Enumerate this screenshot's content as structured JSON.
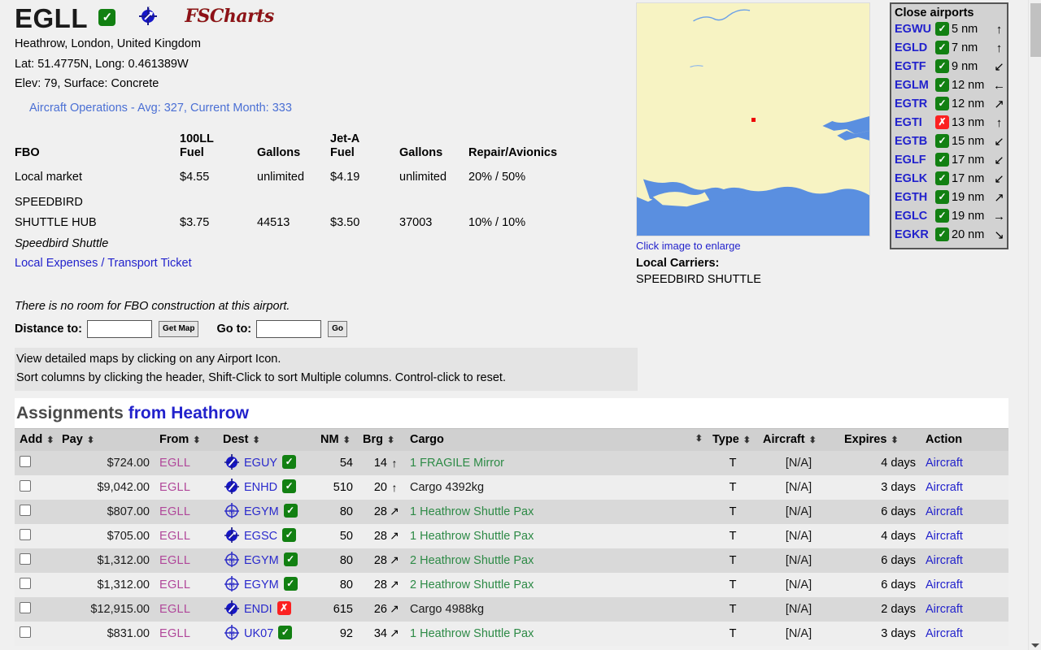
{
  "airport": {
    "icao": "EGLL",
    "status_badge": "check",
    "charts_logo": "FSCharts",
    "location": "Heathrow, London, United Kingdom",
    "latlong": "Lat: 51.4775N, Long: 0.461389W",
    "elev_surface": "Elev: 79, Surface: Concrete",
    "operations": "Aircraft Operations - Avg: 327, Current Month: 333"
  },
  "fbo": {
    "headers": [
      "FBO",
      "100LL Fuel",
      "Gallons",
      "Jet-A Fuel",
      "Gallons",
      "Repair/Avionics"
    ],
    "headers_split": {
      "fbo": "FBO",
      "fuel100ll_l1": "100LL",
      "fuel100ll_l2": "Fuel",
      "gallons1": "Gallons",
      "jeta_l1": "Jet-A",
      "jeta_l2": "Fuel",
      "gallons2": "Gallons",
      "repair": "Repair/Avionics"
    },
    "rows": [
      {
        "name": "Local market",
        "name2": "",
        "fuel100ll": "$4.55",
        "gallons1": "unlimited",
        "jeta": "$4.19",
        "gallons2": "unlimited",
        "repair": "20% / 50%"
      },
      {
        "name": "SPEEDBIRD",
        "name2": "SHUTTLE HUB",
        "fuel100ll": "$3.75",
        "gallons1": "44513",
        "jeta": "$3.50",
        "gallons2": "37003",
        "repair": "10% / 10%"
      }
    ],
    "owner_note": "Speedbird Shuttle",
    "expenses_link": "Local Expenses / Transport Ticket"
  },
  "map": {
    "caption_link": "Click image to enlarge",
    "carriers_label": "Local Carriers:",
    "carriers_value": "SPEEDBIRD SHUTTLE",
    "land_color": "#f7f3c3",
    "water_color": "#5a8fe0",
    "marker_color": "#ee0000"
  },
  "close_airports": {
    "title": "Close airports",
    "items": [
      {
        "code": "EGWU",
        "ok": true,
        "dist": "5 nm",
        "arrow": "↑"
      },
      {
        "code": "EGLD",
        "ok": true,
        "dist": "7 nm",
        "arrow": "↑"
      },
      {
        "code": "EGTF",
        "ok": true,
        "dist": "9 nm",
        "arrow": "↙"
      },
      {
        "code": "EGLM",
        "ok": true,
        "dist": "12 nm",
        "arrow": "←"
      },
      {
        "code": "EGTR",
        "ok": true,
        "dist": "12 nm",
        "arrow": "↗"
      },
      {
        "code": "EGTI",
        "ok": false,
        "dist": "13 nm",
        "arrow": "↑"
      },
      {
        "code": "EGTB",
        "ok": true,
        "dist": "15 nm",
        "arrow": "↙"
      },
      {
        "code": "EGLF",
        "ok": true,
        "dist": "17 nm",
        "arrow": "↙"
      },
      {
        "code": "EGLK",
        "ok": true,
        "dist": "17 nm",
        "arrow": "↙"
      },
      {
        "code": "EGTH",
        "ok": true,
        "dist": "19 nm",
        "arrow": "↗"
      },
      {
        "code": "EGLC",
        "ok": true,
        "dist": "19 nm",
        "arrow": "→"
      },
      {
        "code": "EGKR",
        "ok": true,
        "dist": "20 nm",
        "arrow": "↘"
      }
    ]
  },
  "fbo_note": "There is no room for FBO construction at this airport.",
  "form": {
    "distance_label": "Distance to:",
    "distance_value": "",
    "distance_placeholder": "",
    "get_map_label": "Get Map",
    "goto_label": "Go to:",
    "goto_value": "",
    "goto_placeholder": "",
    "go_label": "Go"
  },
  "help": {
    "line1": "View detailed maps by clicking on any Airport Icon.",
    "line2": "Sort columns by clicking the header, Shift-Click to sort Multiple columns. Control-click to reset."
  },
  "assignments": {
    "title_1": "Assignments",
    "title_2": "from Heathrow",
    "columns": [
      {
        "key": "add",
        "label": "Add",
        "sortable": true
      },
      {
        "key": "pay",
        "label": "Pay",
        "sortable": true
      },
      {
        "key": "from",
        "label": "From",
        "sortable": true
      },
      {
        "key": "dest",
        "label": "Dest",
        "sortable": true
      },
      {
        "key": "nm",
        "label": "NM",
        "sortable": true
      },
      {
        "key": "brg",
        "label": "Brg",
        "sortable": true
      },
      {
        "key": "cargo",
        "label": "Cargo",
        "sortable": true
      },
      {
        "key": "type",
        "label": "Type",
        "sortable": true
      },
      {
        "key": "acft",
        "label": "Aircraft",
        "sortable": true
      },
      {
        "key": "exp",
        "label": "Expires",
        "sortable": true
      },
      {
        "key": "action",
        "label": "Action",
        "sortable": false
      }
    ],
    "sort_glyph": "⬍",
    "rows": [
      {
        "checked": false,
        "pay": "$724.00",
        "from": "EGLL",
        "dest_icon": "vor-compass-icon",
        "dest": "EGUY",
        "dest_ok": true,
        "nm": "54",
        "brg": "14",
        "brg_arrow": "↑",
        "cargo": "1 FRAGILE Mirror",
        "cargo_pax": true,
        "type": "T",
        "aircraft": "[N/A]",
        "expires": "4 days",
        "action": "Aircraft"
      },
      {
        "checked": false,
        "pay": "$9,042.00",
        "from": "EGLL",
        "dest_icon": "vor-compass-icon",
        "dest": "ENHD",
        "dest_ok": true,
        "nm": "510",
        "brg": "20",
        "brg_arrow": "↑",
        "cargo": "Cargo 4392kg",
        "cargo_pax": false,
        "type": "T",
        "aircraft": "[N/A]",
        "expires": "3 days",
        "action": "Aircraft"
      },
      {
        "checked": false,
        "pay": "$807.00",
        "from": "EGLL",
        "dest_icon": "vordme-compass-icon",
        "dest": "EGYM",
        "dest_ok": true,
        "nm": "80",
        "brg": "28",
        "brg_arrow": "↗",
        "cargo": "1 Heathrow Shuttle Pax",
        "cargo_pax": true,
        "type": "T",
        "aircraft": "[N/A]",
        "expires": "6 days",
        "action": "Aircraft"
      },
      {
        "checked": false,
        "pay": "$705.00",
        "from": "EGLL",
        "dest_icon": "ndb-compass-icon",
        "dest": "EGSC",
        "dest_ok": true,
        "nm": "50",
        "brg": "28",
        "brg_arrow": "↗",
        "cargo": "1 Heathrow Shuttle Pax",
        "cargo_pax": true,
        "type": "T",
        "aircraft": "[N/A]",
        "expires": "4 days",
        "action": "Aircraft"
      },
      {
        "checked": false,
        "pay": "$1,312.00",
        "from": "EGLL",
        "dest_icon": "vordme-compass-icon",
        "dest": "EGYM",
        "dest_ok": true,
        "nm": "80",
        "brg": "28",
        "brg_arrow": "↗",
        "cargo": "2 Heathrow Shuttle Pax",
        "cargo_pax": true,
        "type": "T",
        "aircraft": "[N/A]",
        "expires": "6 days",
        "action": "Aircraft"
      },
      {
        "checked": false,
        "pay": "$1,312.00",
        "from": "EGLL",
        "dest_icon": "vordme-compass-icon",
        "dest": "EGYM",
        "dest_ok": true,
        "nm": "80",
        "brg": "28",
        "brg_arrow": "↗",
        "cargo": "2 Heathrow Shuttle Pax",
        "cargo_pax": true,
        "type": "T",
        "aircraft": "[N/A]",
        "expires": "6 days",
        "action": "Aircraft"
      },
      {
        "checked": false,
        "pay": "$12,915.00",
        "from": "EGLL",
        "dest_icon": "vor-compass-icon",
        "dest": "ENDI",
        "dest_ok": false,
        "nm": "615",
        "brg": "26",
        "brg_arrow": "↗",
        "cargo": "Cargo 4988kg",
        "cargo_pax": false,
        "type": "T",
        "aircraft": "[N/A]",
        "expires": "2 days",
        "action": "Aircraft"
      },
      {
        "checked": false,
        "pay": "$831.00",
        "from": "EGLL",
        "dest_icon": "vordme-compass-icon",
        "dest": "UK07",
        "dest_ok": true,
        "nm": "92",
        "brg": "34",
        "brg_arrow": "↗",
        "cargo": "1 Heathrow Shuttle Pax",
        "cargo_pax": true,
        "type": "T",
        "aircraft": "[N/A]",
        "expires": "3 days",
        "action": "Aircraft"
      }
    ]
  }
}
